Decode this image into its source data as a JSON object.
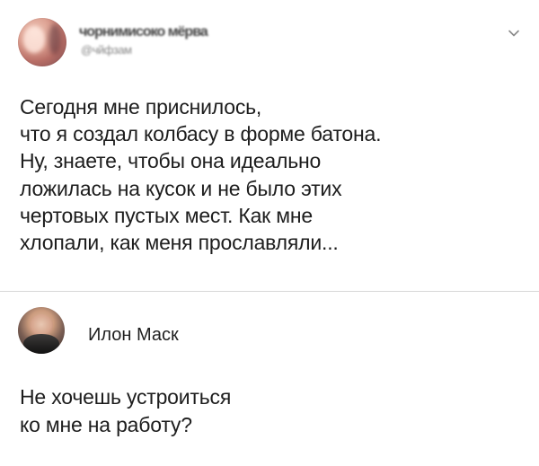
{
  "tweet": {
    "author_name_redacted": "чорнимисоко мёрва",
    "author_handle_redacted": "@чйфзам",
    "menu_icon": "chevron-down-icon",
    "text_lines": [
      "Сегодня мне приснилось,",
      "что я создал колбасу в форме батона.",
      "Ну, знаете, чтобы она идеально",
      "ложилась на кусок и не было этих",
      "чертовых пустых мест. Как мне",
      "хлопали, как меня прославляли..."
    ]
  },
  "reply": {
    "author_name": "Илон Маск",
    "text_lines": [
      "Не хочешь устроиться",
      "ко мне на работу?"
    ]
  },
  "colors": {
    "background": "#ffffff",
    "text": "#1d1d1d",
    "divider": "#d8d8d8",
    "chevron": "#8a8a8a"
  }
}
